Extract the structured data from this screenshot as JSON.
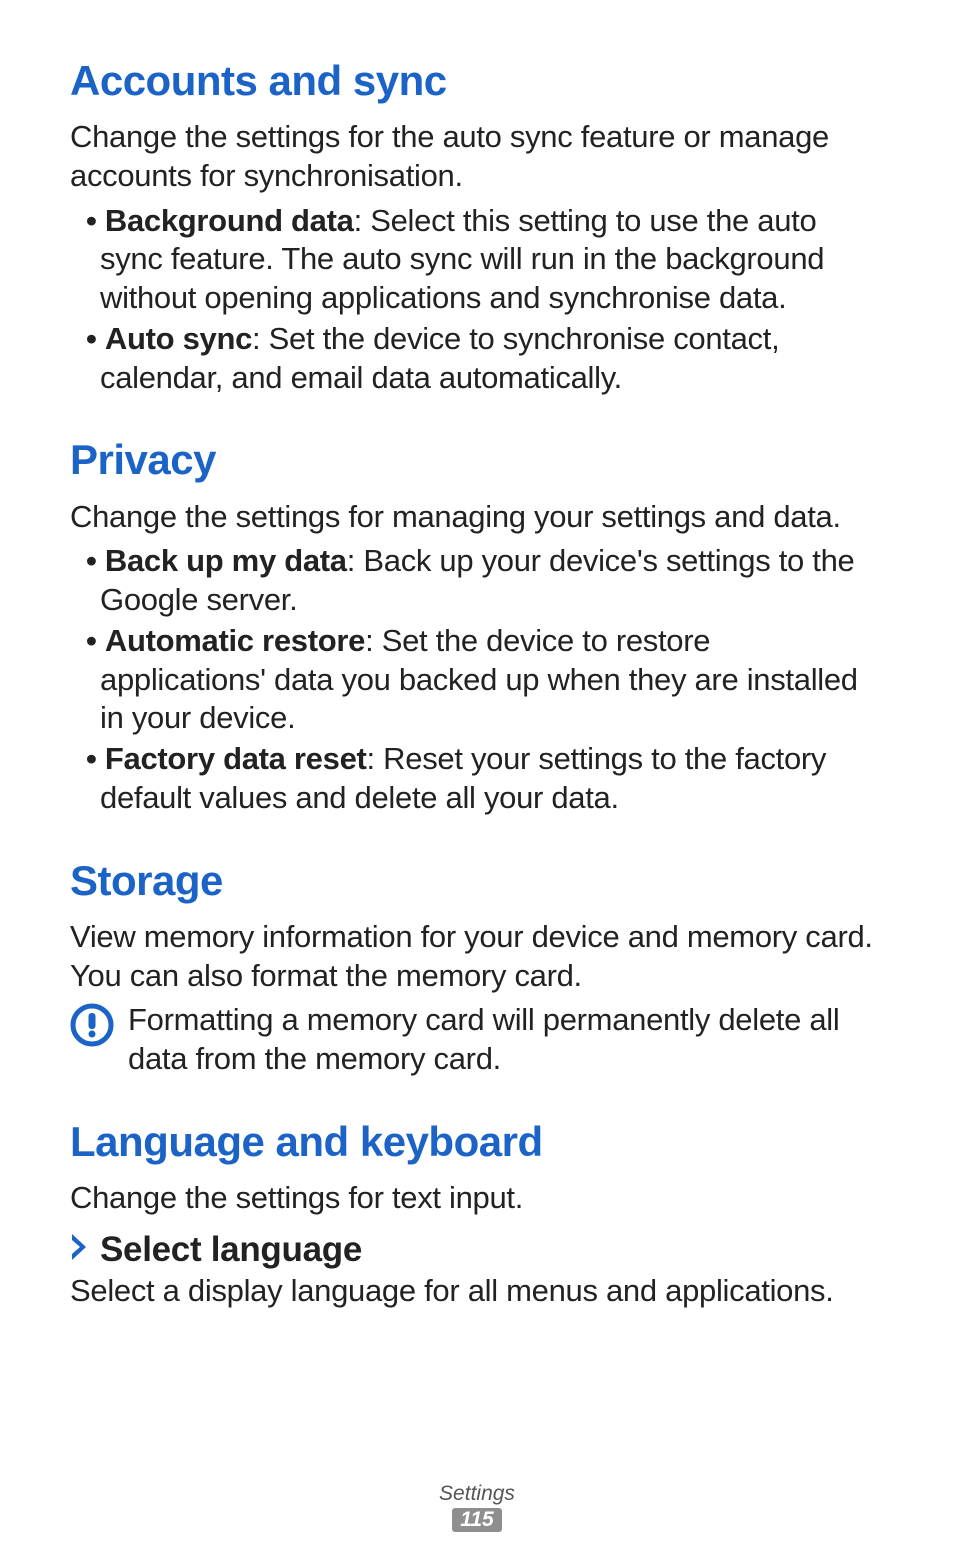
{
  "sections": {
    "accounts": {
      "heading": "Accounts and sync",
      "intro": "Change the settings for the auto sync feature or manage accounts for synchronisation.",
      "items": [
        {
          "label": "Background data",
          "desc": ": Select this setting to use the auto sync feature. The auto sync will run in the background without opening applications and synchronise data."
        },
        {
          "label": "Auto sync",
          "desc": ": Set the device to synchronise contact, calendar, and email data automatically."
        }
      ]
    },
    "privacy": {
      "heading": "Privacy",
      "intro": "Change the settings for managing your settings and data.",
      "items": [
        {
          "label": "Back up my data",
          "desc": ": Back up your device's settings to the Google server."
        },
        {
          "label": "Automatic restore",
          "desc": ": Set the device to restore applications' data you backed up when they are installed in your device."
        },
        {
          "label": "Factory data reset",
          "desc": ": Reset your settings to the factory default values and delete all your data."
        }
      ]
    },
    "storage": {
      "heading": "Storage",
      "intro": "View memory information for your device and memory card. You can also format the memory card.",
      "callout": "Formatting a memory card will permanently delete all data from the memory card."
    },
    "language": {
      "heading": "Language and keyboard",
      "intro": "Change the settings for text input.",
      "sub": {
        "heading": "Select language",
        "desc": "Select a display language for all menus and applications."
      }
    }
  },
  "footer": {
    "title": "Settings",
    "page": "115"
  },
  "colors": {
    "heading": "#1b63c6",
    "callout_icon": "#1b63c6",
    "chevron": "#1b63c6",
    "badge_bg": "#8f8f8f"
  }
}
